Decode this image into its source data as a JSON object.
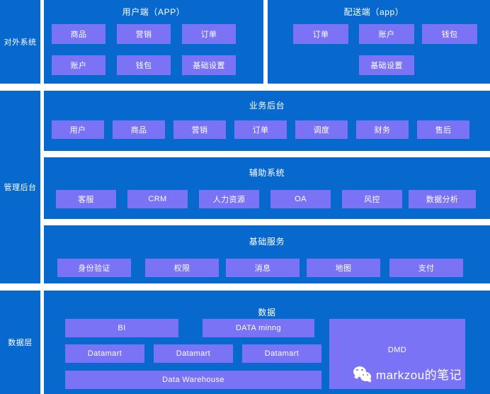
{
  "colors": {
    "background_blue": "#0768ce",
    "module_purple": "#7b73f5",
    "page_white": "#ffffff",
    "text_white": "#ffffff"
  },
  "layers": [
    {
      "id": "external-systems",
      "sidebar_label": "对外系统",
      "panels": [
        {
          "id": "user-app",
          "title": "用户端（APP）",
          "modules": [
            "商品",
            "营销",
            "订单",
            "账户",
            "钱包",
            "基础设置"
          ]
        },
        {
          "id": "delivery-app",
          "title": "配送端（app）",
          "modules": [
            "订单",
            "账户",
            "钱包",
            "基础设置"
          ]
        }
      ]
    },
    {
      "id": "admin-backend",
      "sidebar_label": "管理后台",
      "panels": [
        {
          "id": "business-backend",
          "title": "业务后台",
          "modules": [
            "用户",
            "商品",
            "营销",
            "订单",
            "调度",
            "财务",
            "售后"
          ]
        },
        {
          "id": "auxiliary-systems",
          "title": "辅助系统",
          "modules": [
            "客服",
            "CRM",
            "人力资源",
            "OA",
            "风控",
            "数据分析"
          ]
        },
        {
          "id": "basic-services",
          "title": "基础服务",
          "modules": [
            "身份验证",
            "权限",
            "消息",
            "地图",
            "支付"
          ]
        }
      ]
    },
    {
      "id": "data-layer",
      "sidebar_label": "数据层",
      "panels": [
        {
          "id": "data",
          "title": "数据",
          "modules": [
            "BI",
            "DATA minng",
            "Datamart",
            "Datamart",
            "Datamart",
            "Data Warehouse",
            "DMD"
          ]
        }
      ]
    }
  ],
  "external": {
    "sidebar_label": "对外系统",
    "user_app": {
      "title": "用户端（APP）",
      "row1": [
        "商品",
        "营销",
        "订单"
      ],
      "row2": [
        "账户",
        "钱包",
        "基础设置"
      ]
    },
    "delivery_app": {
      "title": "配送端（app）",
      "row1": [
        "订单",
        "账户",
        "钱包"
      ],
      "row2": [
        "基础设置"
      ]
    }
  },
  "admin": {
    "sidebar_label": "管理后台",
    "business": {
      "title": "业务后台",
      "modules": [
        "用户",
        "商品",
        "营销",
        "订单",
        "调度",
        "财务",
        "售后"
      ]
    },
    "auxiliary": {
      "title": "辅助系统",
      "modules": [
        "客服",
        "CRM",
        "人力资源",
        "OA",
        "风控",
        "数据分析"
      ]
    },
    "basic": {
      "title": "基础服务",
      "modules": [
        "身份验证",
        "权限",
        "消息",
        "地图",
        "支付"
      ]
    }
  },
  "data_layer": {
    "sidebar_label": "数据层",
    "title": "数据",
    "row1": [
      "BI",
      "DATA minng"
    ],
    "row2": [
      "Datamart",
      "Datamart",
      "Datamart"
    ],
    "row3": [
      "Data Warehouse"
    ],
    "dmd": "DMD"
  },
  "watermark": {
    "icon": "wechat-icon",
    "text": "markzou的笔记"
  }
}
